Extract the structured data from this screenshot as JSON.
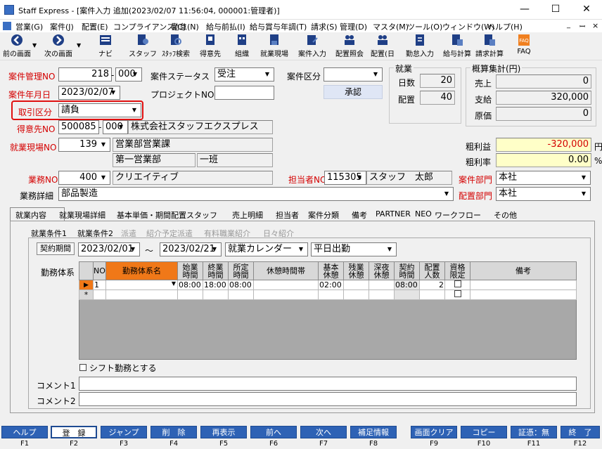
{
  "window": {
    "title": "Staff Express - [案件入力 追加(2023/02/07 11:56:04, 000001:管理者)]",
    "minimize": "—",
    "maximize": "☐",
    "close": "✕"
  },
  "menu": [
    "営業(G)",
    "案件(J)",
    "配置(E)",
    "コンプライアンス(C)",
    "勤怠(N)",
    "給与前払(I)",
    "給与賞与年調(T)",
    "請求(S)",
    "管理(D)",
    "マスタ(M)",
    "ツール(O)",
    "ウィンドウ(W)",
    "ヘルプ(H)"
  ],
  "mdi": {
    "min": "_",
    "restore": "ꟷ",
    "close": "×"
  },
  "toolbar": [
    {
      "label": "前の画面",
      "icon": "arrow-left-icon"
    },
    {
      "label": "次の画面",
      "icon": "arrow-right-icon"
    },
    {
      "label": "ナビ",
      "icon": "navi-icon"
    },
    {
      "label": "スタッフ",
      "icon": "staff-icon"
    },
    {
      "label": "ｽﾀｯﾌ検索",
      "icon": "staff-search-icon"
    },
    {
      "label": "得意先",
      "icon": "customer-icon"
    },
    {
      "label": "組織",
      "icon": "organization-icon"
    },
    {
      "label": "就業現場",
      "icon": "worksite-icon"
    },
    {
      "label": "案件入力",
      "icon": "case-input-icon"
    },
    {
      "label": "配置照会",
      "icon": "placement-inquiry-icon"
    },
    {
      "label": "配置(日",
      "icon": "placement-day-icon"
    },
    {
      "label": "勤怠入力",
      "icon": "attendance-icon"
    },
    {
      "label": "給与計算",
      "icon": "payroll-icon"
    },
    {
      "label": "請求計算",
      "icon": "billing-icon"
    },
    {
      "label": "FAQ",
      "icon": "faq-icon"
    }
  ],
  "form": {
    "case_no_label": "案件管理NO",
    "case_no": "218",
    "case_no_sub": "000",
    "status_label": "案件ステータス",
    "status": "受注",
    "case_type_label": "案件区分",
    "case_type": "",
    "approve_button": "承認",
    "date_label": "案件年月日",
    "date": "2023/02/07",
    "project_label": "プロジェクトNO",
    "project": "",
    "deal_type_label": "取引区分",
    "deal_type": "請負",
    "customer_label": "得意先NO",
    "customer_no": "500085",
    "customer_sub": "000",
    "customer_name": "株式会社スタッフエクスプレス",
    "site_label": "就業現場NO",
    "site_no": "139",
    "site_name": "営業部営業課",
    "site_dept": "第一営業部",
    "site_team": "一班",
    "job_label": "業務NO",
    "job_no": "400",
    "job_name": "クリエイティブ",
    "job_detail_label": "業務詳細",
    "job_detail": "部品製造",
    "staff_label": "担当者NO",
    "staff_no": "115305",
    "staff_name": "スタッフ　太郎",
    "case_dept_label": "案件部門",
    "case_dept": "本社",
    "place_dept_label": "配置部門",
    "place_dept": "本社"
  },
  "work_group": {
    "title": "就業",
    "days_label": "日数",
    "days": "20",
    "place_label": "配置",
    "place": "40"
  },
  "estimate": {
    "title": "概算集計(円)",
    "sales_label": "売上",
    "sales": "0",
    "pay_label": "支給",
    "pay": "320,000",
    "cost_label": "原価",
    "cost": "0",
    "gross_label": "粗利益",
    "gross": "-320,000",
    "gross_unit": "円",
    "rate_label": "粗利率",
    "rate": "0.00",
    "rate_unit": "%"
  },
  "tabs": [
    "就業内容",
    "就業現場詳細",
    "基本単価・期間配置スタッフ",
    "売上明細",
    "担当者",
    "案件分類",
    "備考",
    "PARTNER",
    "NEO",
    "ワークフロー",
    "その他"
  ],
  "subtabs": [
    "就業条件1",
    "就業条件2",
    "派遣",
    "紹介予定派遣",
    "有料職業紹介",
    "日々紹介"
  ],
  "contract": {
    "button": "契約期間",
    "start": "2023/02/01",
    "sep": "～",
    "end": "2023/02/21",
    "calendar": "就業カレンダー",
    "pattern": "平日出勤"
  },
  "grid": {
    "label": "勤務体系",
    "headers": [
      "NO",
      "勤務体系名",
      "始業\n時間",
      "終業\n時間",
      "所定\n時間",
      "休憩時間帯",
      "基本\n休憩",
      "残業\n休憩",
      "深夜\n休憩",
      "契約\n時間",
      "配置\n人数",
      "資格\n限定",
      "備考"
    ],
    "rows": [
      {
        "marker": "▶",
        "no": "1",
        "name": "",
        "start": "08:00",
        "end": "18:00",
        "fixed": "08:00",
        "break_band": "",
        "basic_break": "02:00",
        "ot_break": "",
        "night_break": "",
        "contract": "08:00",
        "count": "2",
        "note": ""
      },
      {
        "marker": "*",
        "no": "",
        "name": "",
        "start": "",
        "end": "",
        "fixed": "",
        "break_band": "",
        "basic_break": "",
        "ot_break": "",
        "night_break": "",
        "contract": "",
        "count": "",
        "note": ""
      }
    ]
  },
  "shift_label": "シフト勤務とする",
  "comment1_label": "コメント1",
  "comment1": "",
  "comment2_label": "コメント2",
  "comment2": "",
  "fkeys": [
    {
      "label": "ヘルプ",
      "key": "F1"
    },
    {
      "label": "登　録",
      "key": "F2"
    },
    {
      "label": "ジャンプ",
      "key": "F3"
    },
    {
      "label": "削　除",
      "key": "F4"
    },
    {
      "label": "再表示",
      "key": "F5"
    },
    {
      "label": "前へ",
      "key": "F6"
    },
    {
      "label": "次へ",
      "key": "F7"
    },
    {
      "label": "補足情報",
      "key": "F8"
    },
    {
      "label": "画面クリア",
      "key": "F9"
    },
    {
      "label": "コピー",
      "key": "F10"
    },
    {
      "label": "証憑：無",
      "key": "F11"
    },
    {
      "label": "終　了",
      "key": "F12"
    }
  ]
}
